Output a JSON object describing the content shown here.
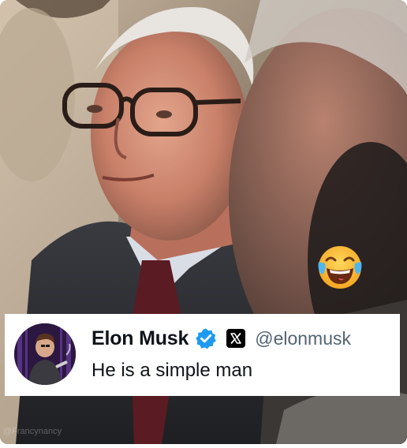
{
  "post": {
    "display_name": "Elon Musk",
    "handle": "@elonmusk",
    "text": "He is a simple man",
    "verified": true,
    "verified_color": "#1d9bf0"
  },
  "overlay": {
    "emoji_name": "face-with-tears-of-joy-icon",
    "watermark": "@Francynancy"
  },
  "platform_logo": "x-logo-icon"
}
